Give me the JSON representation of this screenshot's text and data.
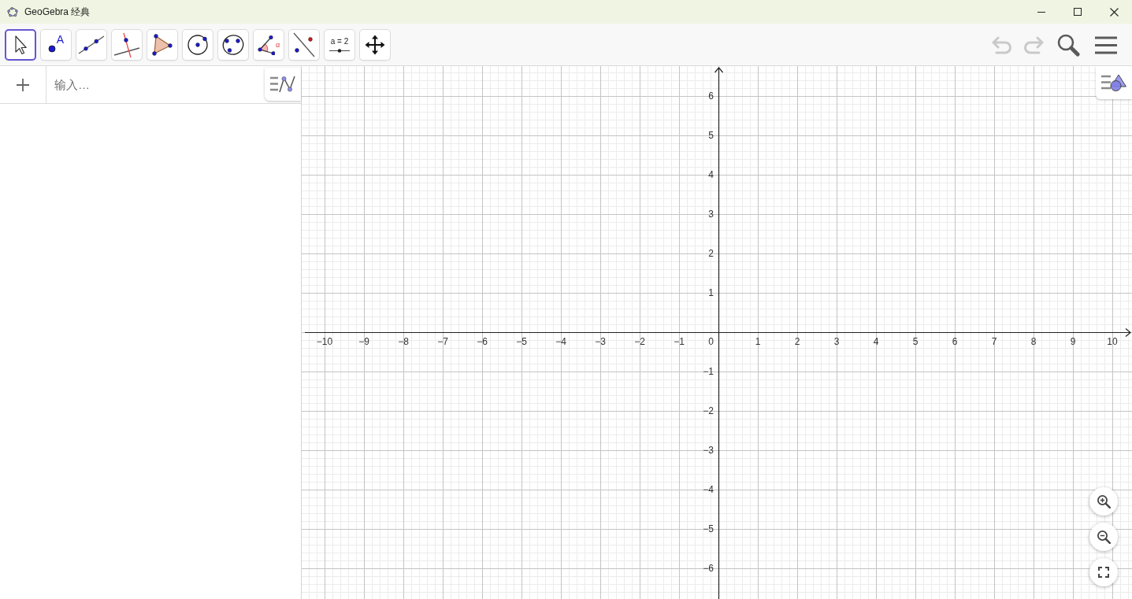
{
  "window": {
    "title": "GeoGebra 经典",
    "controls": [
      {
        "kind": "minimize"
      },
      {
        "kind": "maximize"
      },
      {
        "kind": "close"
      }
    ]
  },
  "toolbar": {
    "tools": [
      {
        "kind": "move",
        "selected": true
      },
      {
        "kind": "point",
        "label": "A",
        "selected": false
      },
      {
        "kind": "line",
        "selected": false
      },
      {
        "kind": "perpendicular",
        "selected": false
      },
      {
        "kind": "polygon",
        "selected": false
      },
      {
        "kind": "circle",
        "selected": false
      },
      {
        "kind": "conic",
        "selected": false
      },
      {
        "kind": "angle",
        "label": "α",
        "selected": false
      },
      {
        "kind": "reflect",
        "selected": false
      },
      {
        "kind": "slider",
        "label": "a = 2",
        "selected": false
      },
      {
        "kind": "move_view",
        "selected": false
      }
    ],
    "actions": [
      {
        "kind": "undo",
        "disabled": true
      },
      {
        "kind": "redo",
        "disabled": true
      },
      {
        "kind": "search",
        "disabled": false
      },
      {
        "kind": "menu",
        "disabled": false
      }
    ]
  },
  "algebra_view": {
    "input": {
      "placeholder": "输入…"
    }
  },
  "graphics_view": {
    "x_tick_labels": [
      "−10",
      "−9",
      "−8",
      "−7",
      "−6",
      "−5",
      "−4",
      "−3",
      "−2",
      "−1",
      "1",
      "2",
      "3",
      "4",
      "5",
      "6",
      "7",
      "8",
      "9",
      "10"
    ],
    "origin_label": "0",
    "y_tick_labels": [
      "6",
      "5",
      "4",
      "3",
      "2",
      "1",
      "−1",
      "−2",
      "−3",
      "−4",
      "−5",
      "−6"
    ],
    "zoom_controls": [
      {
        "kind": "zoom_in"
      },
      {
        "kind": "zoom_out"
      },
      {
        "kind": "fullscreen"
      }
    ]
  }
}
